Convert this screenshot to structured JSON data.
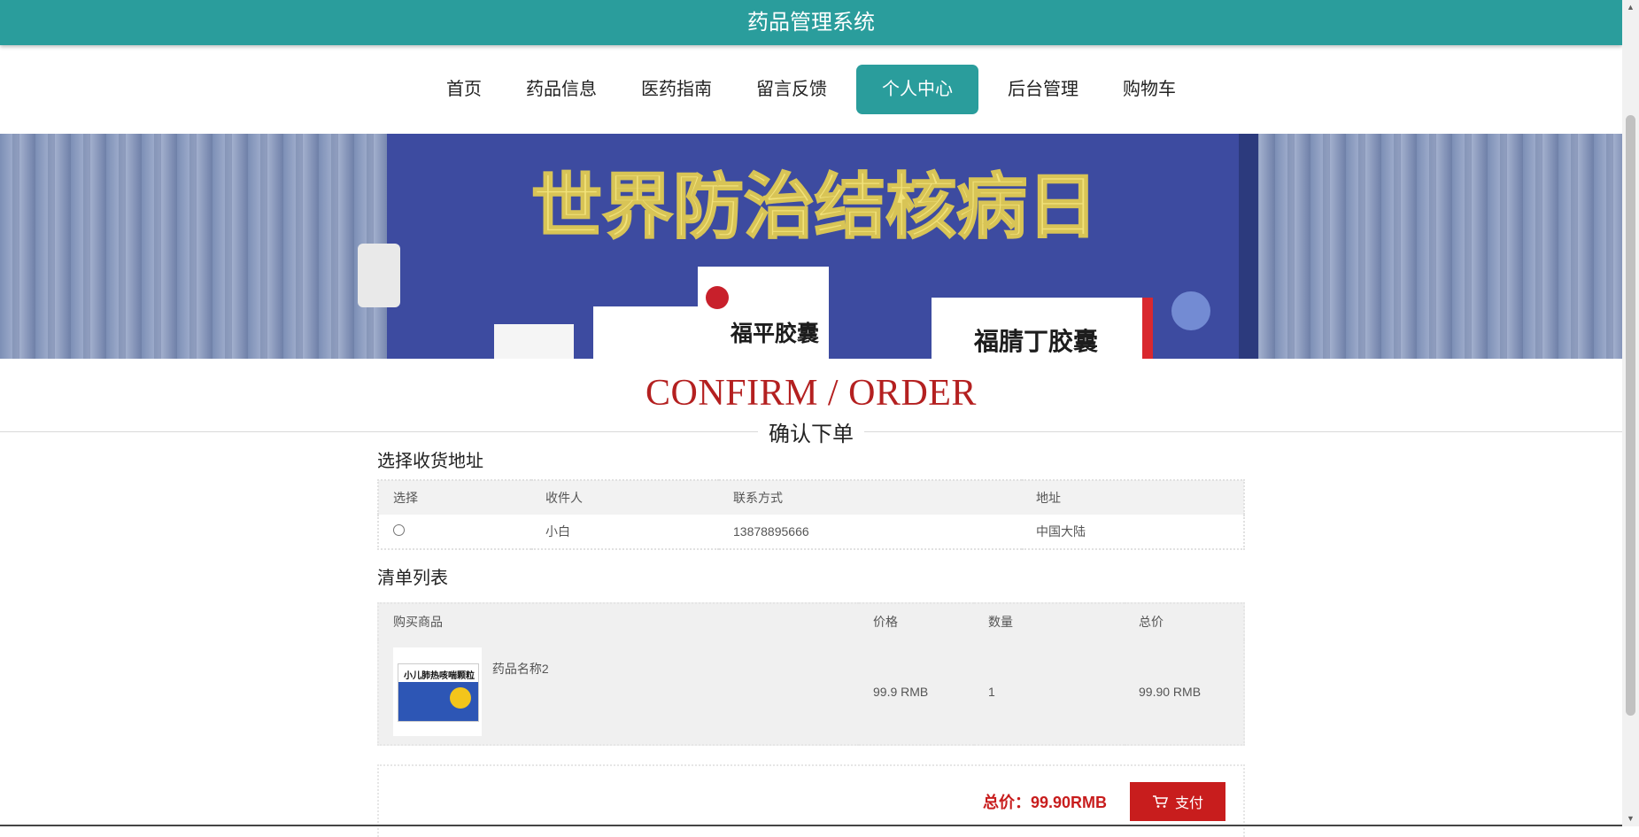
{
  "app": {
    "title": "药品管理系统"
  },
  "nav": {
    "items": [
      "首页",
      "药品信息",
      "医药指南",
      "留言反馈",
      "个人中心",
      "后台管理",
      "购物车"
    ],
    "active": "个人中心"
  },
  "banner": {
    "headline": "世界防治结核病日",
    "box1_text": "福平胶囊",
    "box2_text": "福腈丁胶囊"
  },
  "section": {
    "title": "CONFIRM / ORDER",
    "subtitle": "确认下单"
  },
  "address": {
    "heading": "选择收货地址",
    "columns": [
      "选择",
      "收件人",
      "联系方式",
      "地址"
    ],
    "rows": [
      {
        "selected": false,
        "recipient": "小白",
        "contact": "13878895666",
        "address": "中国大陆"
      }
    ]
  },
  "items": {
    "heading": "清单列表",
    "columns": [
      "购买商品",
      "价格",
      "数量",
      "总价"
    ],
    "rows": [
      {
        "name": "药品名称2",
        "price": "99.9 RMB",
        "qty": "1",
        "total": "99.90 RMB",
        "thumb_text": "小儿肺热咳喘颗粒"
      }
    ]
  },
  "footer": {
    "total_label": "总价：99.90RMB",
    "pay_label": "支付"
  },
  "colors": {
    "brand": "#2a9d9c",
    "accent_red": "#c81d1d",
    "title_red": "#b42020"
  }
}
